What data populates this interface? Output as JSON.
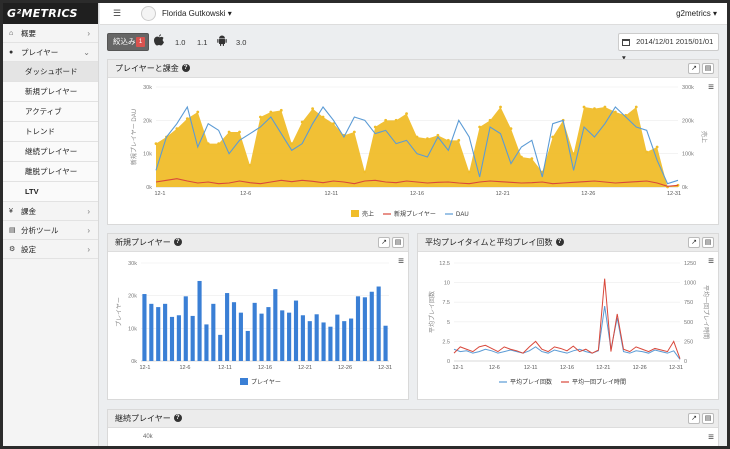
{
  "app": {
    "logo": "G²METRICS"
  },
  "sidebar": {
    "items": [
      {
        "label": "概要",
        "icon": "home-icon",
        "chevron": "›"
      },
      {
        "label": "プレイヤー",
        "icon": "users-icon",
        "chevron": "⌄"
      }
    ],
    "subitems": [
      "ダッシュボード",
      "新規プレイヤー",
      "アクティブ",
      "トレンド",
      "継続プレイヤー",
      "離脱プレイヤー",
      "LTV"
    ],
    "bottom": [
      {
        "label": "課金",
        "icon": "yen-icon",
        "chevron": "›"
      },
      {
        "label": "分析ツール",
        "icon": "database-icon",
        "chevron": "›"
      },
      {
        "label": "設定",
        "icon": "gears-icon",
        "chevron": "›"
      }
    ]
  },
  "topbar": {
    "user": "Florida Gutkowski ▾",
    "account": "g2metrics ▾",
    "menu_icon": "hamburger-icon"
  },
  "filter": {
    "label": "絞込み",
    "badge": "1",
    "versions": [
      "1.0",
      "1.1",
      "3.0"
    ],
    "date_range": "2014/12/01 2015/01/01 ▾"
  },
  "panels": {
    "main": {
      "title": "プレイヤーと課金"
    },
    "newplayers": {
      "title": "新規プレイヤー"
    },
    "playtime": {
      "title": "平均プレイタイムと平均プレイ回数"
    },
    "retention": {
      "title": "継続プレイヤー",
      "first_tick": "40k"
    }
  },
  "chart_data": [
    {
      "type": "area",
      "title": "プレイヤーと課金",
      "ylabel": "新規プレイヤー DAU",
      "ylabel_right": "売上",
      "ylim": [
        0,
        30000
      ],
      "ylim_right": [
        0,
        300000
      ],
      "yticks": [
        "0k",
        "10k",
        "20k",
        "30k"
      ],
      "yticks_right": [
        "0k",
        "100k",
        "200k",
        "300k"
      ],
      "xticks": [
        "12-1",
        "12-6",
        "12-11",
        "12-16",
        "12-21",
        "12-26",
        "12-31"
      ],
      "series": [
        {
          "name": "売上",
          "axis": "right",
          "color": "#f0bd2a",
          "values": [
            130000,
            150000,
            175000,
            205000,
            225000,
            130000,
            130000,
            165000,
            165000,
            65000,
            210000,
            225000,
            230000,
            130000,
            195000,
            235000,
            210000,
            190000,
            155000,
            165000,
            45000,
            180000,
            200000,
            200000,
            220000,
            150000,
            145000,
            155000,
            140000,
            140000,
            45000,
            180000,
            200000,
            240000,
            175000,
            90000,
            85000,
            45000,
            150000,
            200000,
            100000,
            240000,
            235000,
            240000,
            225000,
            215000,
            240000,
            105000,
            120000,
            0,
            5000
          ]
        },
        {
          "name": "新規プレイヤー",
          "color": "#d9483b",
          "values": [
            1500,
            2000,
            2500,
            1800,
            1200,
            1500,
            1000,
            1200,
            1800,
            1300,
            1000,
            1500,
            2000,
            1600,
            2000,
            1700,
            1300,
            1800,
            1500,
            1000,
            1800,
            2000,
            1500,
            1300,
            1800,
            1500,
            1200,
            1400,
            1500,
            1200,
            1000,
            1500,
            1800,
            1600,
            1400,
            1200,
            1300,
            1500,
            1000,
            1200,
            1400,
            1600,
            1800,
            1500,
            1200,
            1400,
            1600,
            1800,
            1200,
            200,
            500
          ]
        },
        {
          "name": "DAU",
          "color": "#5b9bd5",
          "values": [
            5000,
            15000,
            19000,
            24000,
            12000,
            19000,
            17000,
            10000,
            14000,
            16000,
            18000,
            21000,
            16000,
            11000,
            13000,
            19000,
            24000,
            20000,
            15000,
            21000,
            20000,
            16000,
            17000,
            13000,
            14000,
            10000,
            9000,
            15000,
            11000,
            20000,
            15000,
            3000,
            18000,
            16000,
            7000,
            12000,
            14000,
            3000,
            19000,
            20000,
            5000,
            18000,
            15000,
            19000,
            24000,
            21000,
            18000,
            17000,
            8000,
            1000,
            2000
          ]
        }
      ]
    },
    {
      "type": "bar",
      "title": "新規プレイヤー",
      "ylabel": "プレイヤー",
      "ylim": [
        0,
        30000
      ],
      "yticks": [
        "0k",
        "10k",
        "20k",
        "30k"
      ],
      "xticks": [
        "12-1",
        "12-6",
        "12-11",
        "12-16",
        "12-21",
        "12-26",
        "12-31"
      ],
      "series": [
        {
          "name": "プレイヤー",
          "color": "#3a7fd5",
          "values": [
            20500,
            17500,
            16500,
            17500,
            13500,
            14000,
            19800,
            13800,
            24500,
            11200,
            17500,
            8000,
            20800,
            18000,
            14800,
            9200,
            17800,
            14500,
            16500,
            22000,
            15500,
            14800,
            18500,
            14000,
            12200,
            14300,
            11800,
            10500,
            14200,
            12200,
            13000,
            19800,
            19500,
            21200,
            22800,
            10800
          ]
        }
      ]
    },
    {
      "type": "line",
      "title": "平均プレイタイムと平均プレイ回数",
      "ylabel": "平均プレイ回数",
      "ylabel_right": "平均一回プレイ時間",
      "ylim": [
        0,
        12.5
      ],
      "ylim_right": [
        0,
        1250
      ],
      "yticks": [
        "0",
        "2.5",
        "5",
        "7.5",
        "10",
        "12.5"
      ],
      "yticks_right": [
        "0",
        "250",
        "500",
        "750",
        "1000",
        "1250"
      ],
      "xticks": [
        "12-1",
        "12-6",
        "12-11",
        "12-16",
        "12-21",
        "12-26",
        "12-31"
      ],
      "series": [
        {
          "name": "平均プレイ回数",
          "color": "#5b9bd5",
          "values": [
            1.5,
            1.2,
            1.3,
            1.0,
            1.2,
            1.5,
            1.3,
            1.0,
            1.2,
            1.4,
            1.2,
            1.0,
            1.3,
            1.8,
            1.2,
            1.0,
            1.4,
            1.2,
            1.0,
            1.3,
            1.5,
            1.2,
            1.0,
            1.3,
            7.0,
            1.5,
            5.5,
            1.2,
            1.0,
            1.3,
            1.2,
            1.0,
            1.4,
            1.2,
            1.0,
            1.3,
            0.2
          ]
        },
        {
          "name": "平均一回プレイ時間",
          "color": "#d9483b",
          "values": [
            1.0,
            1.8,
            1.5,
            1.2,
            1.8,
            2.0,
            1.6,
            1.2,
            1.8,
            1.5,
            1.3,
            1.0,
            1.8,
            2.5,
            1.5,
            1.2,
            1.8,
            1.6,
            1.3,
            1.9,
            1.2,
            1.5,
            1.0,
            1.4,
            10.5,
            1.2,
            6.0,
            1.5,
            1.2,
            1.8,
            1.5,
            1.2,
            1.6,
            1.4,
            1.2,
            2.5,
            0.3
          ]
        }
      ]
    }
  ],
  "colors": {
    "accent": "#f0bd2a",
    "bar": "#3a7fd5",
    "badge": "#d9534f"
  }
}
